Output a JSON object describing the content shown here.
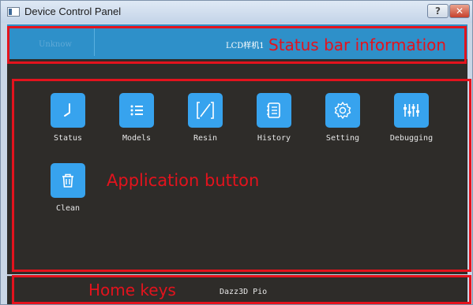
{
  "window": {
    "title": "Device Control Panel",
    "help_label": "?",
    "close_label": "✕"
  },
  "status_bar": {
    "connection_status": "Unknow",
    "device_name": "LCD样机1"
  },
  "apps": [
    {
      "label": "Status",
      "icon": "status-icon"
    },
    {
      "label": "Models",
      "icon": "list-icon"
    },
    {
      "label": "Resin",
      "icon": "resin-icon"
    },
    {
      "label": "History",
      "icon": "document-icon"
    },
    {
      "label": "Setting",
      "icon": "gear-icon"
    },
    {
      "label": "Debugging",
      "icon": "sliders-icon"
    },
    {
      "label": "Clean",
      "icon": "trash-icon"
    }
  ],
  "home": {
    "label": "Dazz3D Pio"
  },
  "annotations": {
    "status_bar": "Status bar information",
    "application": "Application button",
    "home_keys": "Home keys"
  },
  "colors": {
    "accent_blue": "#2e90c9",
    "tile_blue": "#37a3ee",
    "panel_dark": "#2e2c29",
    "annotation_red": "#e3131d"
  }
}
